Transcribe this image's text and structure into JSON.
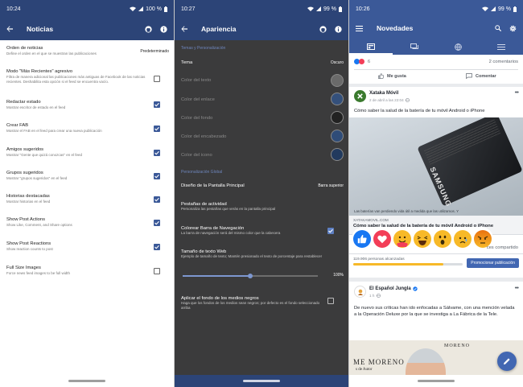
{
  "p1": {
    "status_time": "10:24",
    "battery": "100 %",
    "title": "Noticias",
    "settings": [
      {
        "title": "Orden de noticias",
        "desc": "Define el orden en el que se muestran las publicaciones",
        "value": "Predeterminado"
      },
      {
        "title": "Modo \"Más Recientes\" agresivo",
        "desc": "Filtra de manera adicional las publicaciones más antiguas de Facebook de las noticias recientes. Deshabilita esta opción si el feed se encuentra vacío."
      },
      {
        "title": "Redactar estado",
        "desc": "Mostrar escritor de estado en el feed"
      },
      {
        "title": "Crear FAB",
        "desc": "Mostrar el FAB en el feed para crear una nueva publicación"
      },
      {
        "title": "Amigos sugeridos",
        "desc": "Mostrar \"Gente que quizá conozcas\" en el feed"
      },
      {
        "title": "Grupos sugeridos",
        "desc": "Mostrar \"grupos sugeridos\" en el feed"
      },
      {
        "title": "Historias destacadas",
        "desc": "Mostrar historias en el feed"
      },
      {
        "title": "Show Post Actions",
        "desc": "Show Like, Comment, and Share options"
      },
      {
        "title": "Show Post Reactions",
        "desc": "Show reaction counts to post"
      },
      {
        "title": "Full Size Images",
        "desc": "Force news feed images to be full width"
      }
    ]
  },
  "p2": {
    "status_time": "10:27",
    "battery": "99 %",
    "title": "Apariencia",
    "section1": "Temas y Personalización",
    "theme_label": "Tema",
    "theme_value": "Oscuro",
    "colors": [
      "Color del texto",
      "Color del enlace",
      "Color del fondo",
      "Color del encabezado",
      "Color del icono"
    ],
    "color_values": [
      "#6a6a6a",
      "#34507b",
      "#222222",
      "#2f4c78",
      "#223a5e"
    ],
    "section2": "Personalización Global",
    "layout_label": "Diseño de la Pantalla Principal",
    "layout_value": "Barra superior",
    "tabs_title": "Pestañas de actividad",
    "tabs_desc": "Personaliza las pestañas que verás en la pantalla principal",
    "navbar_title": "Colorear Barra de Navegación",
    "navbar_desc": "La barra de navegación será del mismo color que la cabecera",
    "textsize_title": "Tamaño de texto Web",
    "textsize_desc": "Ejemplo de tamaño de texto; Mantén presionado el texto de porcentaje para restablecer",
    "textsize_value": "100%",
    "textsize_fraction": 0.5,
    "amoled_title": "Aplicar el fondo de los medios negros",
    "amoled_desc": "Haga que los fondos de los medios sean negros; por defecto es el fondo seleccionado arriba"
  },
  "p3": {
    "status_time": "10:26",
    "battery": "99 %",
    "title": "Novedades",
    "reaction_count": "6",
    "comments": "2 comentarios",
    "like_btn": "Me gusta",
    "comment_btn": "Comentar",
    "post1": {
      "author": "Xataka Móvil",
      "meta": "2 de abril a las 22:04 · ",
      "text": "Cómo saber la salud de la batería de tu móvil Android o iPhone",
      "battery_brand": "SAMSUNG",
      "battery_fine": "Las baterías van perdiendo vida útil a medida que las utilizamos. Y",
      "link_domain": "XATAKAMOVIL.COM",
      "link_title": "Cómo saber la salud de la batería de tu móvil Android o iPhone",
      "shared": "ces compartido",
      "reach": "119.906 personas alcanzadas",
      "reach_fraction": 0.82,
      "promote": "Promocionar publicación"
    },
    "post2": {
      "author": "El Español Jungla",
      "meta": "1 h · ",
      "text": "De nuevo sus críticas han ido enfocadas a Sálvame, con una mención velada a la Operación Deluxe por la que se investiga a La Fábrica de la Tele.",
      "photo_top": "MORENO",
      "photo_left": "ME MORENO",
      "photo_sub": "s de Autor"
    }
  },
  "colors": {
    "fb_blue": "#3b5998",
    "dark_header": "#2c4477",
    "dark_bg": "#3b3b3c"
  }
}
